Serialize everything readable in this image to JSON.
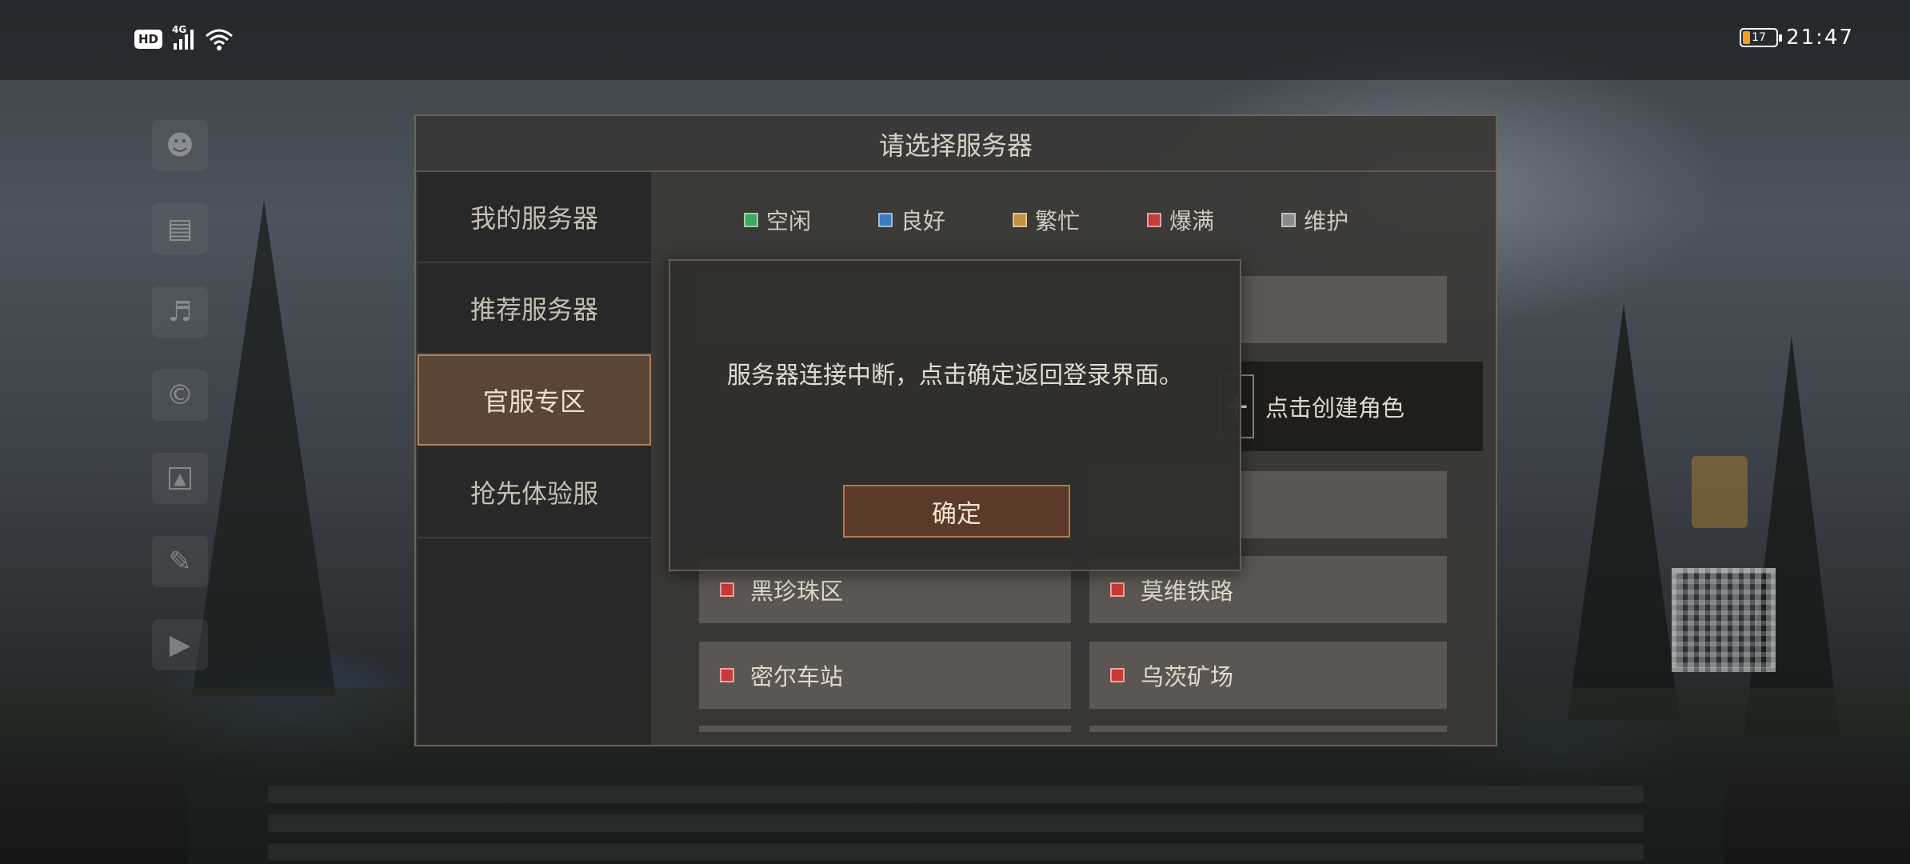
{
  "status_bar": {
    "hd_label": "HD",
    "network_label": "4G",
    "battery_level": "17",
    "time": "21:47"
  },
  "panel": {
    "title": "请选择服务器",
    "tabs": [
      {
        "label": "我的服务器",
        "active": false
      },
      {
        "label": "推荐服务器",
        "active": false
      },
      {
        "label": "官服专区",
        "active": true
      },
      {
        "label": "抢先体验服",
        "active": false
      }
    ],
    "legend": [
      {
        "label": "空闲",
        "color": "#3aa860"
      },
      {
        "label": "良好",
        "color": "#3a7ac0"
      },
      {
        "label": "繁忙",
        "color": "#c09040"
      },
      {
        "label": "爆满",
        "color": "#c83a3a"
      },
      {
        "label": "维护",
        "color": "#8a8a8a"
      }
    ],
    "create_role_label": "点击创建角色",
    "servers": [
      {
        "name": "黑珍珠区",
        "status_color": "#c83a3a"
      },
      {
        "name": "莫维铁路",
        "status_color": "#c83a3a"
      },
      {
        "name": "密尔车站",
        "status_color": "#c83a3a"
      },
      {
        "name": "乌茨矿场",
        "status_color": "#c83a3a"
      }
    ]
  },
  "dialog": {
    "message": "服务器连接中断，点击确定返回登录界面。",
    "confirm_label": "确定"
  }
}
